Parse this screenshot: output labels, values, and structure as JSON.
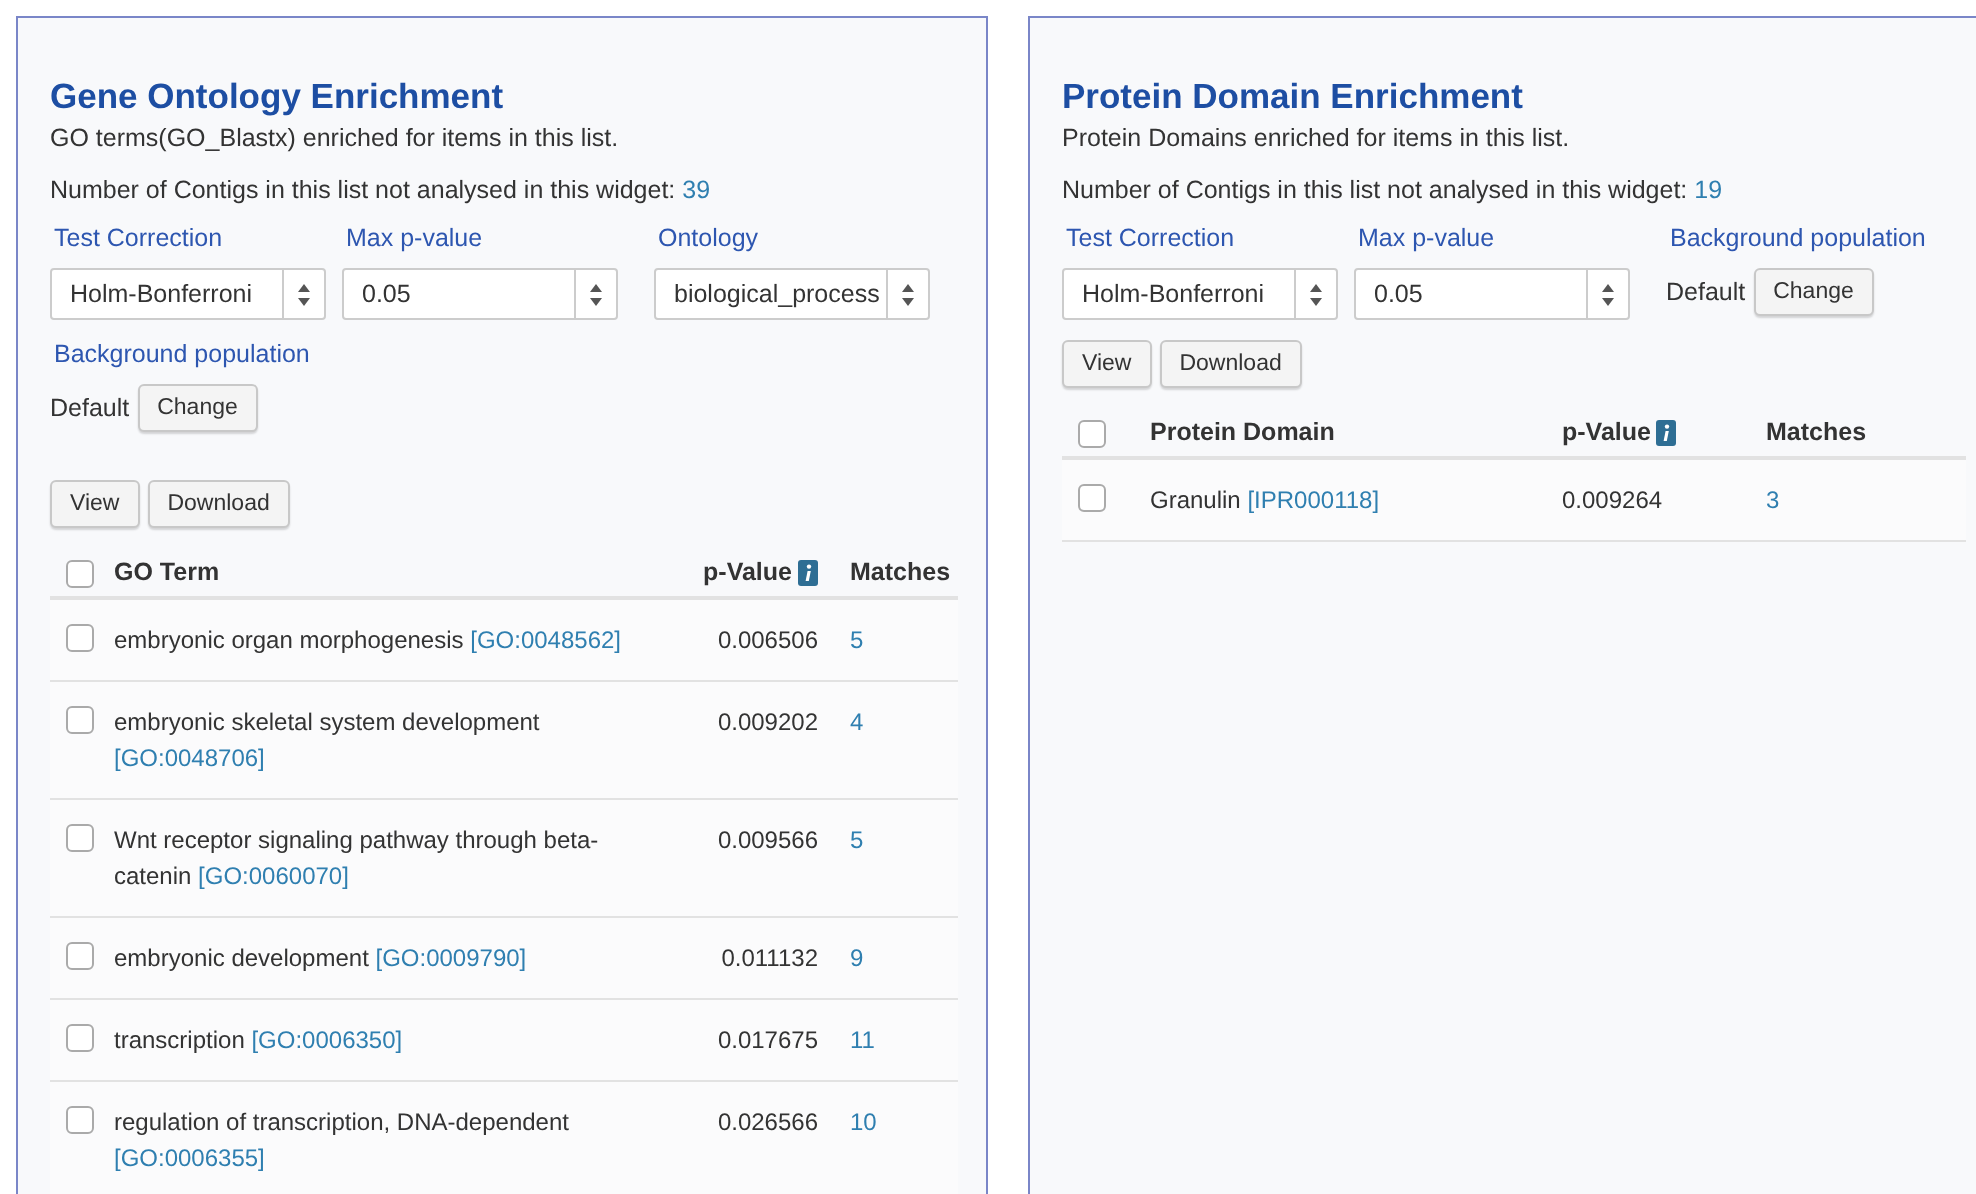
{
  "panels": [
    {
      "title": "Gene Ontology Enrichment",
      "subtitle": "GO terms(GO_Blastx) enriched for items in this list.",
      "not_analysed": {
        "label": "Number of Contigs in this list not analysed in this widget:",
        "count": "39"
      },
      "controls": [
        {
          "kind": "select",
          "label": "Test Correction",
          "value": "Holm-Bonferroni"
        },
        {
          "kind": "select",
          "label": "Max p-value",
          "value": "0.05"
        },
        {
          "kind": "select",
          "label": "Ontology",
          "value": "biological_process"
        },
        {
          "kind": "background",
          "label": "Background population",
          "value": "Default",
          "button": "Change"
        }
      ],
      "actions": [
        "View",
        "Download"
      ],
      "table": {
        "select_all_checked": false,
        "columns": [
          "GO Term",
          "p-Value",
          "Matches"
        ],
        "rows": [
          {
            "checked": false,
            "text": "embryonic organ morphogenesis",
            "ref": "[GO:0048562]",
            "p_value": "0.006506",
            "matches": "5"
          },
          {
            "checked": false,
            "text": "embryonic skeletal system development",
            "ref": "[GO:0048706]",
            "p_value": "0.009202",
            "matches": "4"
          },
          {
            "checked": false,
            "text": "Wnt receptor signaling pathway through beta-catenin",
            "ref": "[GO:0060070]",
            "p_value": "0.009566",
            "matches": "5"
          },
          {
            "checked": false,
            "text": "embryonic development",
            "ref": "[GO:0009790]",
            "p_value": "0.011132",
            "matches": "9"
          },
          {
            "checked": false,
            "text": "transcription",
            "ref": "[GO:0006350]",
            "p_value": "0.017675",
            "matches": "11"
          },
          {
            "checked": false,
            "text": "regulation of transcription, DNA-dependent",
            "ref": "[GO:0006355]",
            "p_value": "0.026566",
            "matches": "10"
          }
        ]
      }
    },
    {
      "title": "Protein Domain Enrichment",
      "subtitle": "Protein Domains enriched for items in this list.",
      "not_analysed": {
        "label": "Number of Contigs in this list not analysed in this widget:",
        "count": "19"
      },
      "controls": [
        {
          "kind": "select",
          "label": "Test Correction",
          "value": "Holm-Bonferroni"
        },
        {
          "kind": "select",
          "label": "Max p-value",
          "value": "0.05"
        },
        {
          "kind": "background",
          "label": "Background population",
          "value": "Default",
          "button": "Change"
        }
      ],
      "actions": [
        "View",
        "Download"
      ],
      "table": {
        "select_all_checked": false,
        "columns": [
          "Protein Domain",
          "p-Value",
          "Matches"
        ],
        "rows": [
          {
            "checked": false,
            "text": "Granulin",
            "ref": "[IPR000118]",
            "p_value": "0.009264",
            "matches": "3"
          }
        ]
      }
    }
  ]
}
